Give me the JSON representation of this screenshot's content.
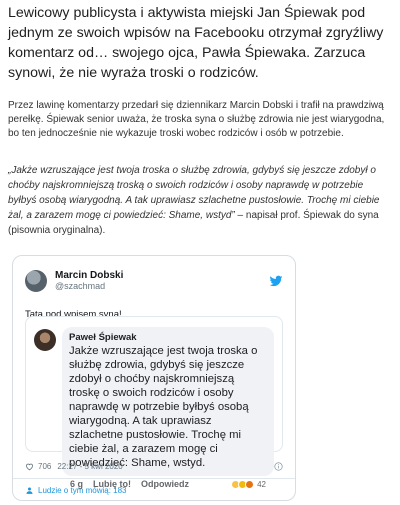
{
  "article": {
    "lead": "Lewicowy publicysta i aktywista miejski Jan Śpiewak pod jednym ze swoich wpisów na Facebooku otrzymał zgryźliwy komentarz od… swojego ojca, Pawła Śpiewaka. Zarzuca synowi, że nie wyraża troski o rodziców.",
    "paragraph": "Przez lawinę komentarzy przedarł się dziennikarz Marcin Dobski i trafił na prawdziwą perełkę. Śpiewak senior uważa, że troska syna o służbę zdrowia nie jest wiarygodna, bo ten jednocześnie nie wykazuje troski wobec rodziców i osób w potrzebie.",
    "quote_italic": "„Jakże wzruszające jest twoja troska o służbę zdrowia, gdybyś się jeszcze zdobył o choćby najskromniejszą troską o swoich rodziców i osoby naprawdę w potrzebie byłbyś osobą wiarygodną. A tak uprawiasz szlachetne pustosłowie. Trochę mi ciebie żal, a zarazem mogę ci powiedzieć: Shame, wstyd”",
    "quote_tail": " – napisał prof. Śpiewak do syna (pisownia oryginalna)."
  },
  "tweet": {
    "author_name": "Marcin Dobski",
    "author_handle": "@szachmad",
    "text": "Tata pod wpisem syna!",
    "embedded_comment": {
      "author": "Paweł Śpiewak",
      "text": "Jakże wzruszające jest twoja troska o służbę zdrowia, gdybyś się jeszcze zdobył o choćby najskromniejszą troskę o swoich rodziców i osoby naprawdę w potrzebie  byłbyś osobą wiarygodną. A tak uprawiasz szlachetne pustosłowie. Trochę mi ciebie żal, a zarazem mogę ci powiedzieć: Shame, wstyd.",
      "time": "6 g",
      "like_label": "Lubię to!",
      "reply_label": "Odpowiedz",
      "reaction_count": "42"
    },
    "likes": "706",
    "timestamp": "22:27 - 5 kwi 2020",
    "footer_link": "Ludzie o tym mówią: 183"
  },
  "colors": {
    "twitter_blue": "#1da1f2",
    "link_blue": "#1b95e0"
  },
  "icons": [
    "twitter-bird-icon",
    "heart-icon",
    "info-icon",
    "people-icon"
  ]
}
